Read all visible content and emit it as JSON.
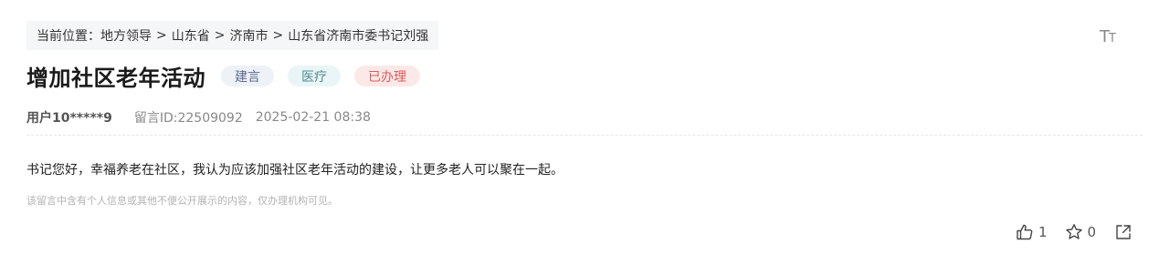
{
  "breadcrumb": {
    "prefix": "当前位置：",
    "items": [
      "地方领导",
      "山东省",
      "济南市",
      "山东省济南市委书记刘强"
    ],
    "separator": ">"
  },
  "font_toggle": {
    "big": "T",
    "small": "T",
    "icon": "font-size-icon"
  },
  "message": {
    "title": "增加社区老年活动",
    "tags": [
      {
        "label": "建言",
        "bg": "#eef1f7",
        "color": "#5b6a8c"
      },
      {
        "label": "医疗",
        "bg": "#e9f5f6",
        "color": "#4f8a94"
      },
      {
        "label": "已办理",
        "bg": "#fde8e8",
        "color": "#e05a5a"
      }
    ],
    "user": "用户10*****9",
    "message_id": "留言ID:22509092",
    "datetime": "2025-02-21 08:38",
    "body": "书记您好，幸福养老在社区，我认为应该加强社区老年活动的建设，让更多老人可以聚在一起。",
    "privacy_notice": "该留言中含有个人信息或其他不便公开展示的内容，仅办理机构可见。"
  },
  "actions": {
    "like": {
      "icon": "thumbs-up-icon",
      "count": "1"
    },
    "favorite": {
      "icon": "star-icon",
      "count": "0"
    },
    "share": {
      "icon": "share-icon"
    }
  }
}
